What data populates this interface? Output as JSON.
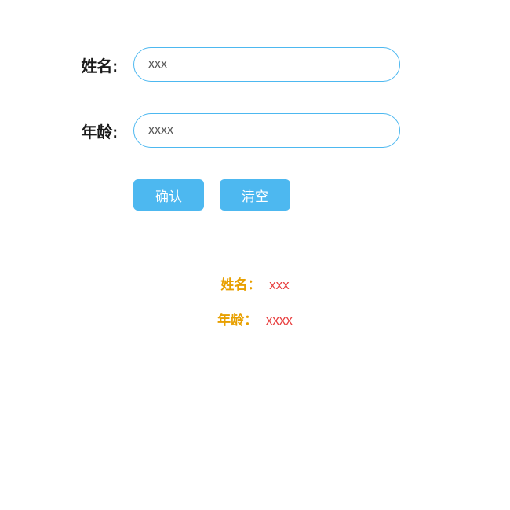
{
  "form": {
    "name_label": "姓名:",
    "name_placeholder": "xxx",
    "age_label": "年龄:",
    "age_placeholder": "xxxx",
    "confirm_button": "确认",
    "clear_button": "清空"
  },
  "result": {
    "name_label": "姓名：",
    "name_value": "xxx",
    "age_label": "年龄：",
    "age_value": "xxxx"
  }
}
